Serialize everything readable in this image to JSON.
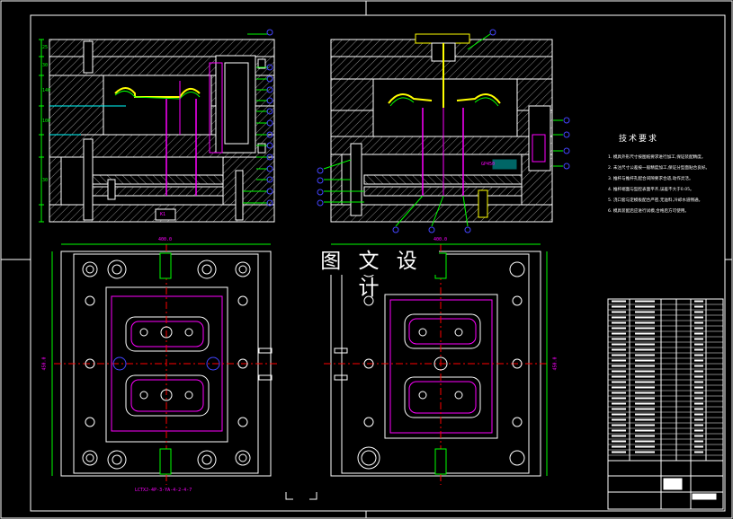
{
  "watermark": "图 文 设 计",
  "requirements": {
    "title": "技术要求",
    "lines": [
      "1. 模具外形尺寸按图纸要求进行加工,保证装配精度。",
      "2. 未注尺寸公差按一般精度加工,保证分型面贴合良好。",
      "3. 推杆与推杆孔配合间隙要求合适,动作灵活。",
      "4. 推杆端面与型腔表面平齐,误差不大于0.05。",
      "5. 浇口套与定模板配合严密,无溢料,冷却水道畅通。",
      "6. 模具装配后应进行试模,合格后方可使用。"
    ]
  },
  "dimensions": {
    "width_left": "400.0",
    "width_right": "400.0",
    "height_left": "450.0",
    "height_right": "450.0"
  },
  "pink_labels": {
    "bottom_note": "LCTXJ-4P-3-YA-4-2-4-7",
    "center_mark": "GP450",
    "left_plate": "K1",
    "left_stack": [
      "25",
      "30",
      "140",
      "100",
      "30"
    ]
  },
  "bom": {
    "rows": 30,
    "title_block": [
      "图号",
      "材料",
      "数量"
    ]
  },
  "colors": {
    "background": "#000000",
    "outline": "#ffffff",
    "hatch": "#7f7f7f",
    "dimension": "#00ff00",
    "leader": "#ff00ff",
    "balloon": "#0000ff",
    "centerline": "#ff0000",
    "sprue": "#ffff00",
    "cooling": "#00ffff"
  }
}
